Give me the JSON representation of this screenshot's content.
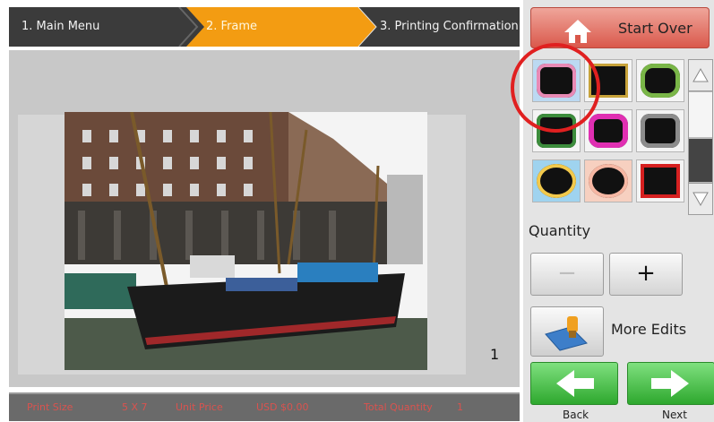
{
  "steps": [
    {
      "label": "1. Main Menu"
    },
    {
      "label": "2. Frame"
    },
    {
      "label": "3. Printing Confirmation"
    }
  ],
  "preview": {
    "page_number": "1"
  },
  "info_bar": {
    "print_size_label": "Print Size",
    "print_size_value": "5 X 7",
    "unit_price_label": "Unit Price",
    "unit_price_value": "USD $0.00",
    "total_quantity_label": "Total Quantity",
    "total_quantity_value": "1"
  },
  "right_panel": {
    "start_over_label": "Start Over",
    "quantity_label": "Quantity",
    "minus_label": "−",
    "plus_label": "+",
    "more_edits_label": "More Edits",
    "back_label": "Back",
    "next_label": "Next"
  },
  "frames": [
    {
      "name": "frame-pink-blob",
      "edge": "#e88ab5",
      "bg": "#bcd9f2"
    },
    {
      "name": "frame-gold-ornate",
      "edge": "#c7a23a",
      "bg": "#1a1a1a"
    },
    {
      "name": "frame-floral-green",
      "edge": "#7ab648",
      "bg": "#2a2a2a"
    },
    {
      "name": "frame-green-splash",
      "edge": "#3c8c3c",
      "bg": "#0d0d0d"
    },
    {
      "name": "frame-magenta",
      "edge": "#e02fb2",
      "bg": "#0d0d0d"
    },
    {
      "name": "frame-smoke",
      "edge": "#8c8c8c",
      "bg": "#0d0d0d"
    },
    {
      "name": "frame-gold-rainbow",
      "edge": "#f2c94c",
      "bg": "#9fd3ef"
    },
    {
      "name": "frame-peach-oval",
      "edge": "#f7b7a3",
      "bg": "#f7d0c0"
    },
    {
      "name": "frame-red-rect",
      "edge": "#d62020",
      "bg": "#ffffff"
    }
  ],
  "colors": {
    "active_step": "#f39c12",
    "start_over": "#d9574a",
    "nav_green": "#2ea82e",
    "highlight": "#e02020"
  }
}
